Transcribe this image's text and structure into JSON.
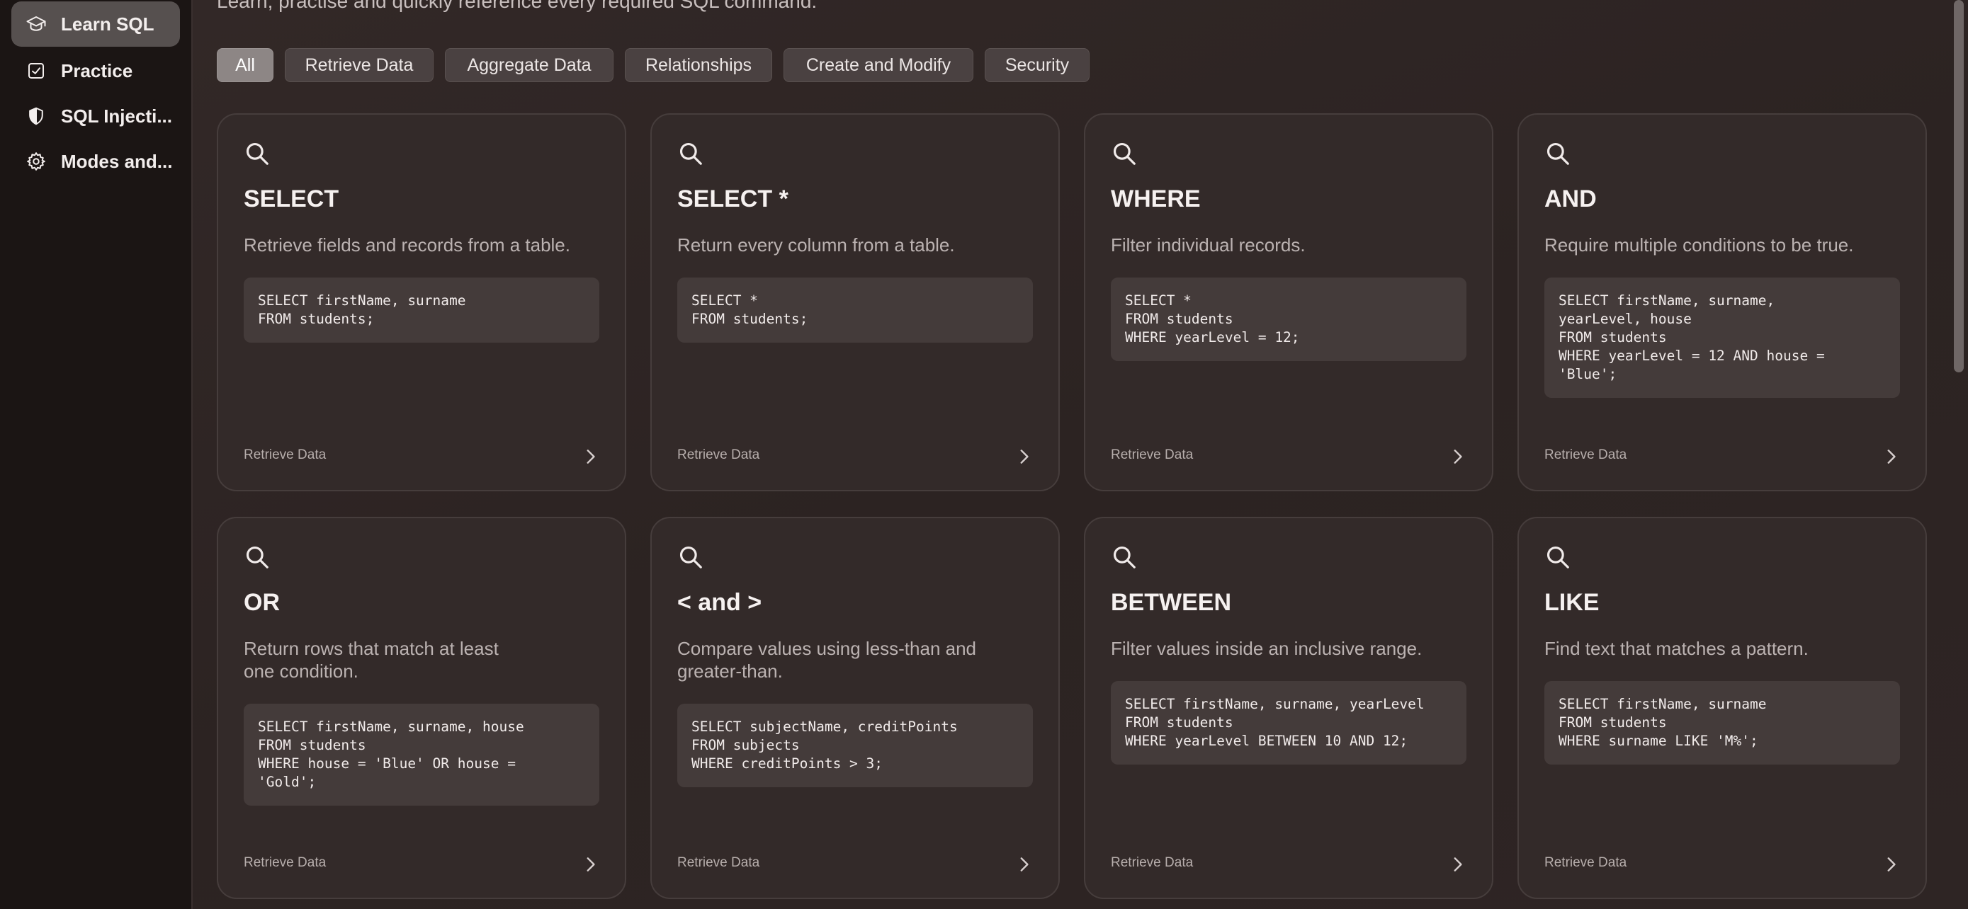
{
  "sidebar": {
    "items": [
      {
        "label": "Learn SQL",
        "icon": "graduation-cap-icon",
        "active": true
      },
      {
        "label": "Practice",
        "icon": "checkbox-icon",
        "active": false
      },
      {
        "label": "SQL Injecti...",
        "icon": "shield-icon",
        "active": false
      },
      {
        "label": "Modes and...",
        "icon": "gear-icon",
        "active": false
      }
    ]
  },
  "main": {
    "subtitle": "Learn, practise and quickly reference every required SQL command.",
    "filters": [
      "All",
      "Retrieve Data",
      "Aggregate Data",
      "Relationships",
      "Create and Modify",
      "Security"
    ],
    "active_filter": "All",
    "cards": [
      {
        "title": "SELECT",
        "description": "Retrieve fields and records from a table.",
        "code": "SELECT firstName, surname\nFROM students;",
        "category": "Retrieve Data"
      },
      {
        "title": "SELECT *",
        "description": "Return every column from a table.",
        "code": "SELECT *\nFROM students;",
        "category": "Retrieve Data"
      },
      {
        "title": "WHERE",
        "description": "Filter individual records.",
        "code": "SELECT *\nFROM students\nWHERE yearLevel = 12;",
        "category": "Retrieve Data"
      },
      {
        "title": "AND",
        "description": "Require multiple conditions to be true.",
        "code": "SELECT firstName, surname,\nyearLevel, house\nFROM students\nWHERE yearLevel = 12 AND house =\n'Blue';",
        "category": "Retrieve Data"
      },
      {
        "title": "OR",
        "description": "Return rows that match at least\none condition.",
        "code": "SELECT firstName, surname, house\nFROM students\nWHERE house = 'Blue' OR house =\n'Gold';",
        "category": "Retrieve Data"
      },
      {
        "title": "< and >",
        "description": "Compare values using less-than and\ngreater-than.",
        "code": "SELECT subjectName, creditPoints\nFROM subjects\nWHERE creditPoints > 3;",
        "category": "Retrieve Data"
      },
      {
        "title": "BETWEEN",
        "description": "Filter values inside an inclusive range.",
        "code": "SELECT firstName, surname, yearLevel\nFROM students\nWHERE yearLevel BETWEEN 10 AND 12;",
        "category": "Retrieve Data"
      },
      {
        "title": "LIKE",
        "description": "Find text that matches a pattern.",
        "code": "SELECT firstName, surname\nFROM students\nWHERE surname LIKE 'M%';",
        "category": "Retrieve Data"
      }
    ]
  },
  "colors": {
    "sidebar_bg": "#1b1514",
    "main_bg": "#2e2524",
    "card_bg": "#332a29",
    "code_bg": "#443b3a",
    "active_pill": "#8d8685"
  }
}
